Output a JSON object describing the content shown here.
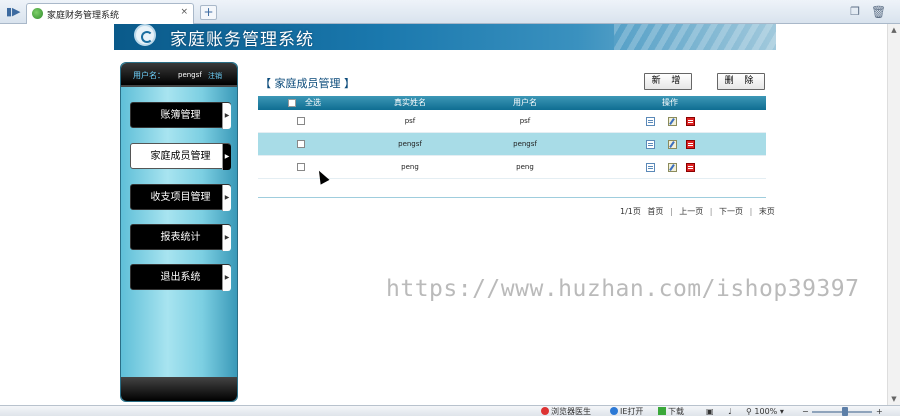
{
  "browser": {
    "tab_title": "家庭财务管理系统",
    "tab_close": "×",
    "new_tab": "+",
    "back_icon": "arrow-back-icon",
    "restore_icon": "window-restore-icon",
    "trash_icon": "trash-icon"
  },
  "status_bar": {
    "items": [
      {
        "label": "浏览器医生",
        "icon": "doctor-icon"
      },
      {
        "label": "IE打开",
        "icon": "ie-icon"
      },
      {
        "label": "下载",
        "icon": "download-icon"
      }
    ],
    "zoom": "100%",
    "zoom_minus": "−",
    "zoom_plus": "+"
  },
  "header": {
    "title": "家庭账务管理系统"
  },
  "sidebar": {
    "user_label": "用户名：",
    "username": "pengsf",
    "logout": "注销",
    "items": [
      {
        "label": "账簿管理",
        "active": false
      },
      {
        "label": "家庭成员管理",
        "active": true
      },
      {
        "label": "收支项目管理",
        "active": false
      },
      {
        "label": "报表统计",
        "active": false
      },
      {
        "label": "退出系统",
        "active": false
      }
    ]
  },
  "main": {
    "section_title": "【 家庭成员管理 】",
    "add_button": "新 增",
    "delete_button": "删 除",
    "table": {
      "headers": {
        "select_all": "全选",
        "real_name": "真实姓名",
        "username": "用户名",
        "actions": "操作"
      },
      "rows": [
        {
          "real_name": "psf",
          "username": "psf"
        },
        {
          "real_name": "pengsf",
          "username": "pengsf"
        },
        {
          "real_name": "peng",
          "username": "peng"
        }
      ]
    },
    "pager": {
      "page_info": "1/1页",
      "first": "首页",
      "prev": "上一页",
      "next": "下一页",
      "last": "末页",
      "separator": "|"
    }
  },
  "watermark": "https://www.huzhan.com/ishop39397"
}
